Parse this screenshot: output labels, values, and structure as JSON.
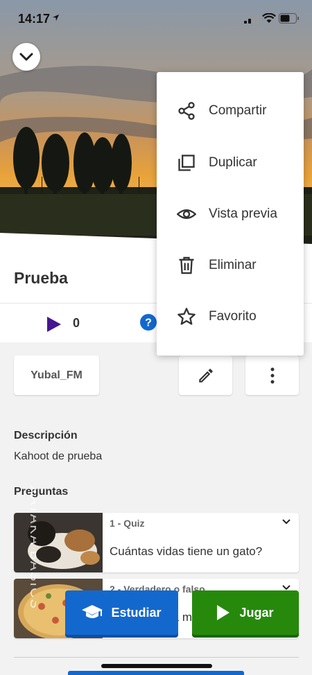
{
  "status_bar": {
    "time": "14:17"
  },
  "kahoot": {
    "title": "Prueba",
    "plays": "0",
    "owner": "Yubal_FM",
    "description_heading": "Descripción",
    "description": "Kahoot de prueba",
    "questions_heading": "Preguntas"
  },
  "questions": [
    {
      "type": "1 - Quiz",
      "text": "Cuántas vidas tiene un gato?"
    },
    {
      "type": "2 - Verdadero o falso",
      "text": "Es la pizza la mejor comida"
    }
  ],
  "actions": {
    "study": "Estudiar",
    "play": "Jugar"
  },
  "menu": {
    "items": [
      {
        "label": "Compartir",
        "icon": "share-icon"
      },
      {
        "label": "Duplicar",
        "icon": "duplicate-icon"
      },
      {
        "label": "Vista previa",
        "icon": "eye-icon"
      },
      {
        "label": "Eliminar",
        "icon": "trash-icon"
      },
      {
        "label": "Favorito",
        "icon": "star-icon"
      }
    ]
  },
  "colors": {
    "blue": "#1368ce",
    "green": "#26890c",
    "purple": "#46178f",
    "qblue": "#1368ce"
  },
  "watermark": "XATAKA BASICS"
}
